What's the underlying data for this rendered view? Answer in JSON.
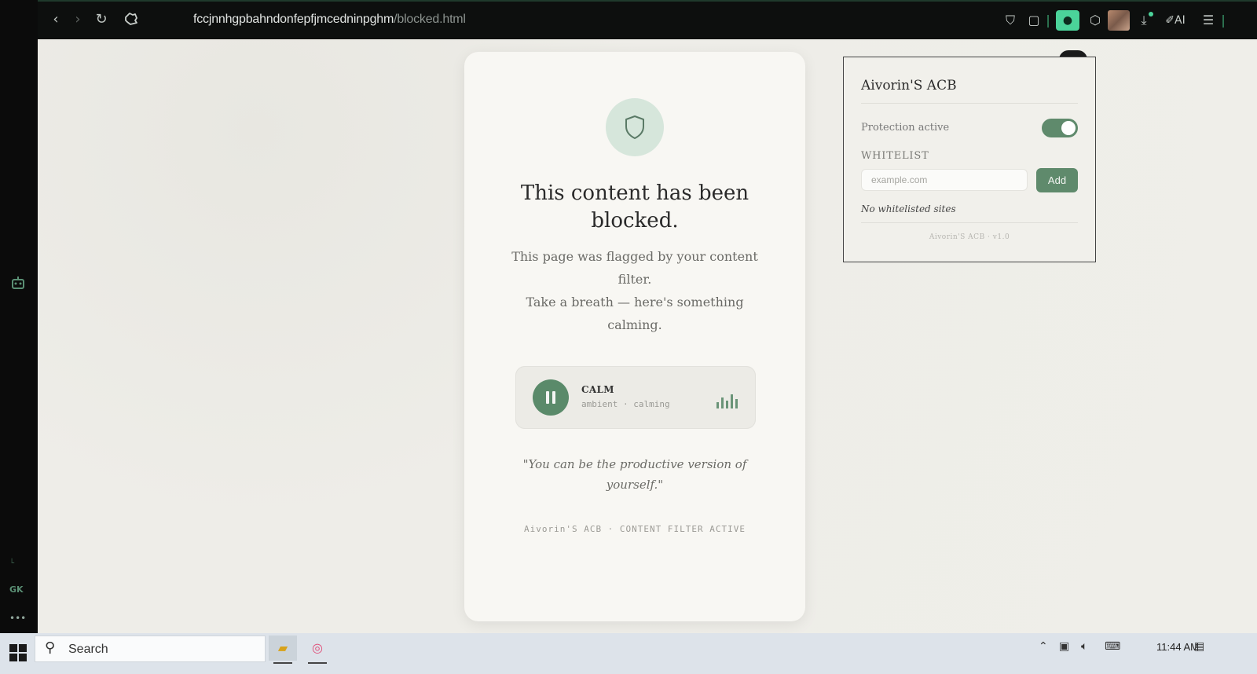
{
  "browser": {
    "url_host": "fccjnnhgpbahndonfepfjmcedninpghm",
    "url_path": "/blocked.html",
    "extension_ai_label": "AI"
  },
  "blocked_page": {
    "headline": "This content has been blocked.",
    "message_line1": "This page was flagged by your content filter.",
    "message_line2": "Take a breath — here's something calming.",
    "player": {
      "title": "CALM",
      "subtitle": "ambient · calming",
      "state": "playing"
    },
    "quote": "\"You can be the productive version of yourself.\"",
    "footer": "Aivorin'S ACB · CONTENT FILTER ACTIVE"
  },
  "popup": {
    "title": "Aivorin'S ACB",
    "protection_label": "Protection active",
    "protection_on": true,
    "whitelist_label": "WHITELIST",
    "whitelist_placeholder": "example.com",
    "add_label": "Add",
    "empty_text": "No whitelisted sites",
    "version": "Aivorin'S ACB · v1.0"
  },
  "sidebar": {
    "label": "GK"
  },
  "taskbar": {
    "search_label": "Search",
    "time": "11:44 AM"
  },
  "colors": {
    "accent_green": "#5f8a6c",
    "shield_bg": "#d6e6db",
    "card_bg": "#f8f7f3",
    "page_bg": "#eeede8"
  }
}
